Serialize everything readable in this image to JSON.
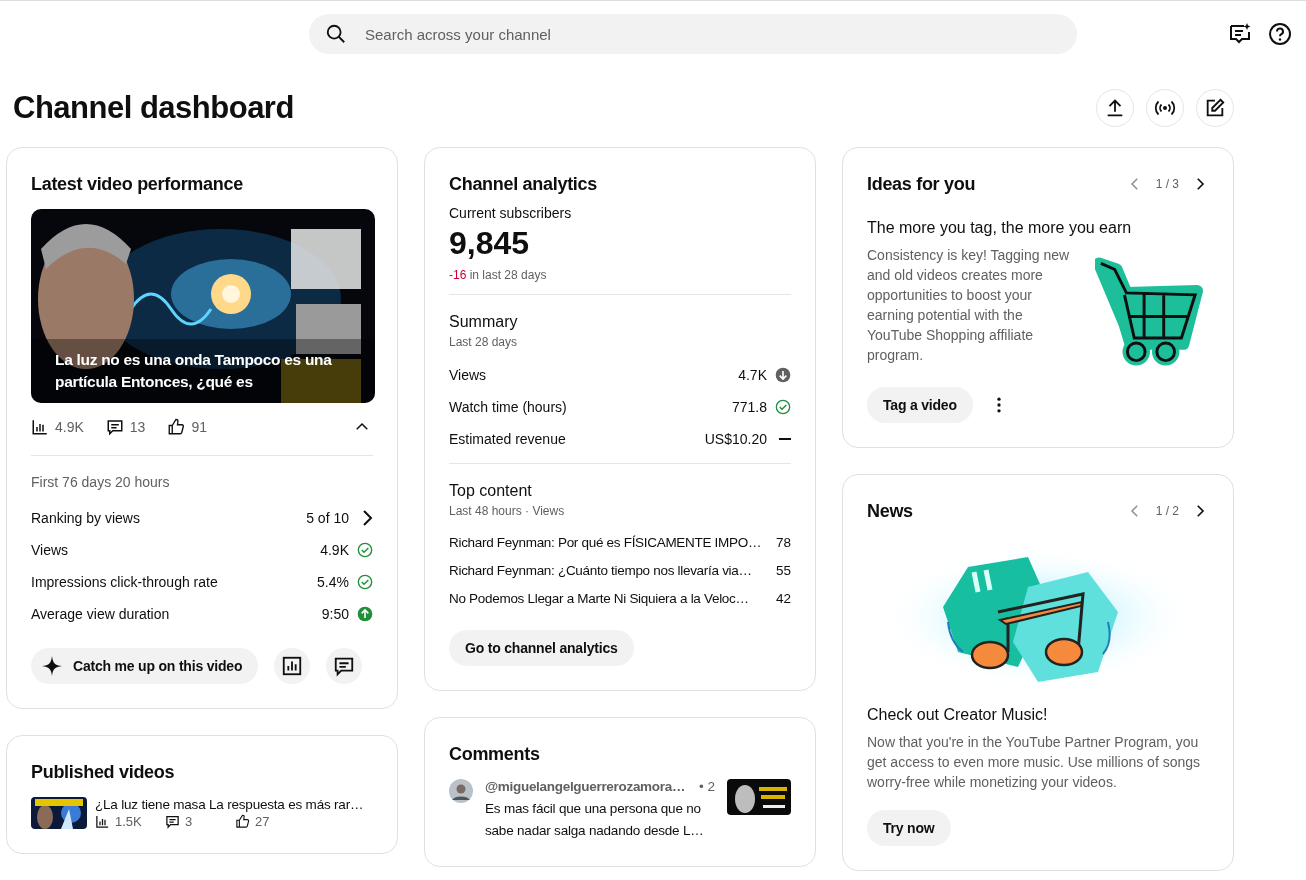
{
  "search": {
    "placeholder": "Search across your channel"
  },
  "page_title": "Channel dashboard",
  "latest_video": {
    "title": "Latest video performance",
    "video_title": "La luz no es una onda Tampoco es una partícula Entonces, ¿qué es",
    "views": "4.9K",
    "comments": "13",
    "likes": "91",
    "expanded": true,
    "period": "First 76 days 20 hours",
    "stats": [
      {
        "label": "Ranking by views",
        "value": "5 of 10",
        "kind": "chevron"
      },
      {
        "label": "Views",
        "value": "4.9K",
        "kind": "check"
      },
      {
        "label": "Impressions click-through rate",
        "value": "5.4%",
        "kind": "check"
      },
      {
        "label": "Average view duration",
        "value": "9:50",
        "kind": "up"
      }
    ],
    "button": "Catch me up on this video"
  },
  "published_videos": {
    "title": "Published videos",
    "items": [
      {
        "title": "¿La luz tiene masa La respuesta es más rar…",
        "views": "1.5K",
        "comments": "3",
        "likes": "27"
      }
    ]
  },
  "channel_analytics": {
    "title": "Channel analytics",
    "subscribers_label": "Current subscribers",
    "subscribers": "9,845",
    "change": "-16",
    "change_suffix": "in last 28 days",
    "summary": {
      "title": "Summary",
      "subtitle": "Last 28 days",
      "rows": [
        {
          "label": "Views",
          "value": "4.7K",
          "kind": "down"
        },
        {
          "label": "Watch time (hours)",
          "value": "771.8",
          "kind": "check"
        },
        {
          "label": "Estimated revenue",
          "value": "US$10.20",
          "kind": "dash"
        }
      ]
    },
    "top_content": {
      "title": "Top content",
      "subtitle": "Last 48 hours · Views",
      "rows": [
        {
          "title": "Richard Feynman: Por qué es FÍSICAMENTE IMPO…",
          "views": "78"
        },
        {
          "title": "Richard Feynman: ¿Cuánto tiempo nos llevaría via…",
          "views": "55"
        },
        {
          "title": "No Podemos Llegar a Marte Ni Siquiera a la Veloc…",
          "views": "42"
        }
      ]
    },
    "button": "Go to channel analytics"
  },
  "comments": {
    "title": "Comments",
    "items": [
      {
        "author": "@miguelangelguerrerozamora…",
        "time": "• 2",
        "text": "Es mas fácil que una persona que no sabe nadar salga nadando desde L…"
      }
    ]
  },
  "ideas": {
    "title": "Ideas for you",
    "pager": "1 / 3",
    "heading": "The more you tag, the more you earn",
    "body": "Consistency is key! Tagging new and old videos creates more opportunities to boost your earning potential with the YouTube Shopping affiliate program.",
    "button": "Tag a video"
  },
  "news": {
    "title": "News",
    "pager": "1 / 2",
    "heading": "Check out Creator Music!",
    "body": "Now that you're in the YouTube Partner Program, you get access to even more music. Use millions of songs worry-free while monetizing your videos.",
    "button": "Try now"
  }
}
